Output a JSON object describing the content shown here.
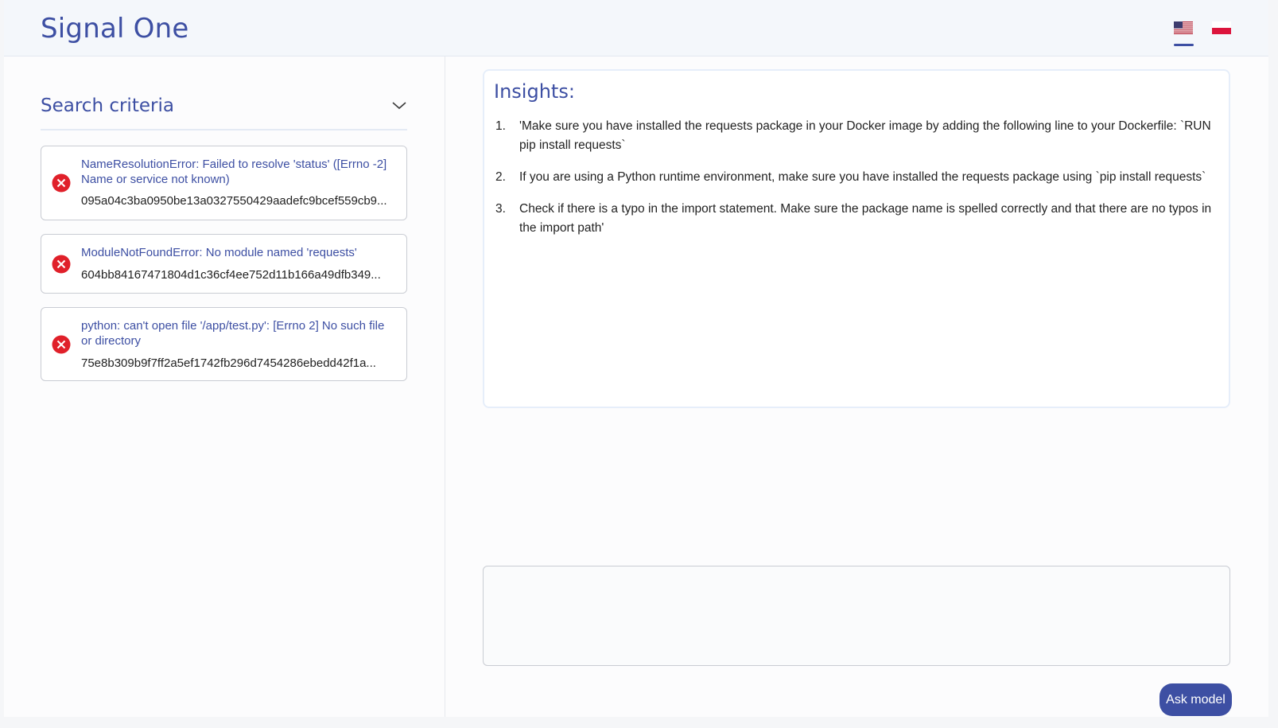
{
  "header": {
    "brand": "Signal One",
    "languages": [
      {
        "code": "en",
        "icon": "us-flag-icon",
        "active": true
      },
      {
        "code": "pl",
        "icon": "pl-flag-icon",
        "active": false
      }
    ]
  },
  "sidebar": {
    "search_label": "Search criteria",
    "issues": [
      {
        "title": "NameResolutionError: Failed to resolve 'status' ([Errno -2] Name or service not known)",
        "hash": "095a04c3ba0950be13a0327550429aadefc9bcef559cb9...",
        "icon": "error-icon"
      },
      {
        "title": "ModuleNotFoundError: No module named 'requests'",
        "hash": "604bb84167471804d1c36cf4ee752d11b166a49dfb349...",
        "icon": "error-icon"
      },
      {
        "title": "python: can't open file '/app/test.py': [Errno 2] No such file or directory",
        "hash": "75e8b309b9f7ff2a5ef1742fb296d7454286ebedd42f1a...",
        "icon": "error-icon"
      }
    ]
  },
  "main": {
    "insights_title": "Insights:",
    "insights": [
      {
        "num": "1.",
        "text": "'Make sure you have installed the requests package in your Docker image by adding the following line to your Dockerfile: `RUN pip install requests`"
      },
      {
        "num": "2.",
        "text": "If you are using a Python runtime environment, make sure you have installed the requests package using `pip install requests`"
      },
      {
        "num": "3.",
        "text": "Check if there is a typo in the import statement. Make sure the package name is spelled correctly and that there are no typos in the import path'"
      }
    ],
    "prompt_value": "",
    "ask_button": "Ask model"
  },
  "colors": {
    "accent": "#3d4fa3",
    "error": "#e0202a",
    "header_bg": "#f4f7fb"
  }
}
